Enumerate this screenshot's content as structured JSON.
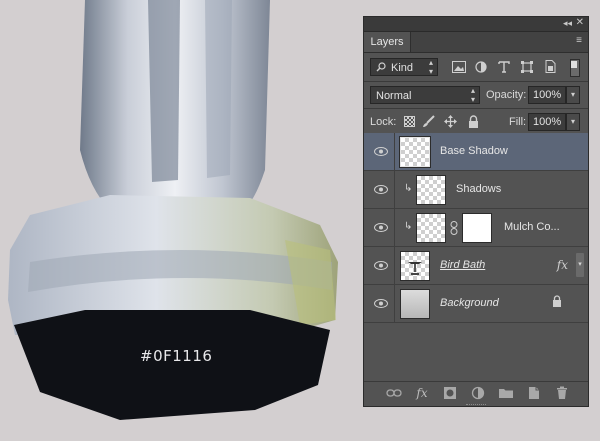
{
  "canvas": {
    "swatch_label": "#0F1116",
    "swatch_color": "#0F1116",
    "background_color": "#d3cfd0"
  },
  "panel": {
    "tab_label": "Layers",
    "collapse_glyph": "◂◂",
    "close_glyph": "✕",
    "menu_glyph": "≡",
    "filter_kind_label": "Kind",
    "blend_mode": "Normal",
    "opacity_label": "Opacity:",
    "opacity_value": "100%",
    "lock_label": "Lock:",
    "fill_label": "Fill:",
    "fill_value": "100%",
    "filter_icons": [
      "image-filter-icon",
      "adjustment-filter-icon",
      "type-filter-icon",
      "shape-filter-icon",
      "smart-object-filter-icon",
      "filter-toggle-icon"
    ],
    "lock_icons": [
      "lock-transparent-icon",
      "lock-image-icon",
      "lock-position-icon",
      "lock-all-icon"
    ],
    "bottom_icons": [
      "link-layers-icon",
      "fx-icon",
      "add-mask-icon",
      "new-adjustment-icon",
      "new-group-icon",
      "new-layer-icon",
      "trash-icon"
    ],
    "fx_glyph": "fx"
  },
  "layers": [
    {
      "name": "Base Shadow",
      "selected": true
    },
    {
      "name": "Shadows",
      "clipped": true
    },
    {
      "name": "Mulch Co...",
      "clipped": true,
      "has_mask": true
    },
    {
      "name": "Bird Bath",
      "has_fx": true
    },
    {
      "name": "Background",
      "locked": true
    }
  ],
  "colors": {
    "panel_bg": "#535353",
    "selected_row": "#5c6678"
  }
}
